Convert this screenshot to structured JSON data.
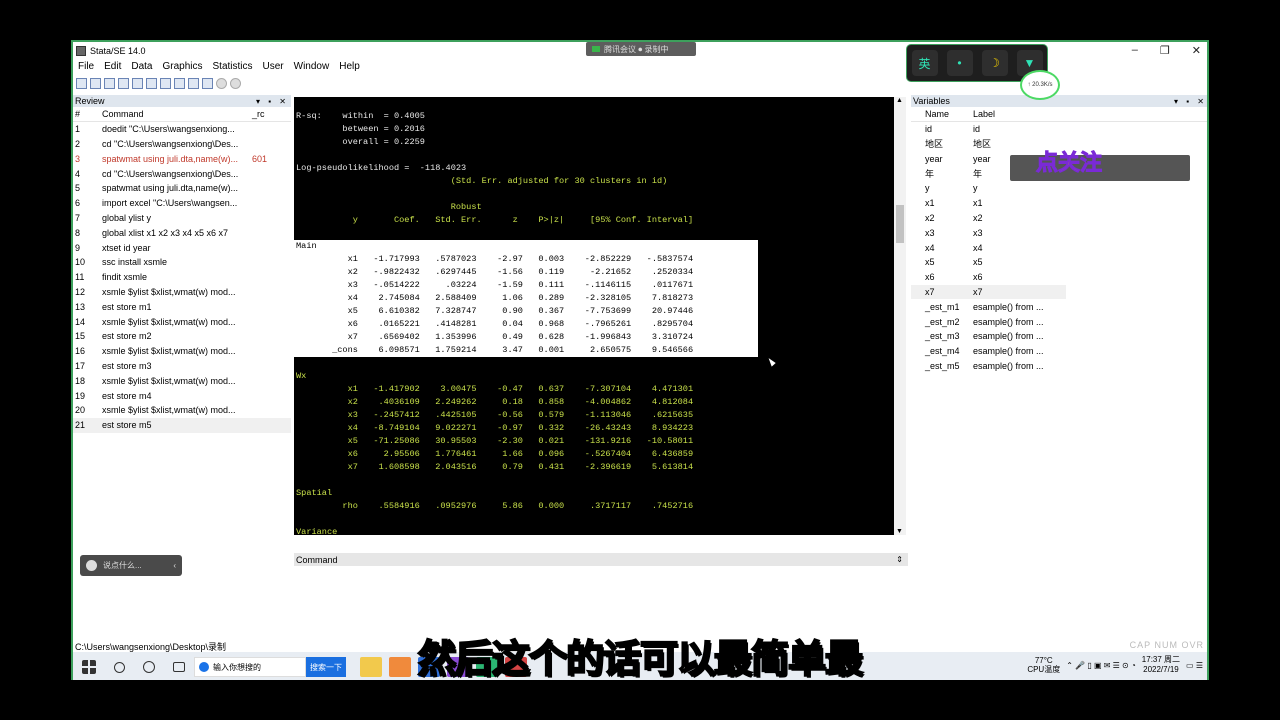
{
  "window": {
    "title": "Stata/SE 14.0",
    "meeting_badge": "腾讯会议 ⏺ 录制中"
  },
  "menu": [
    "File",
    "Edit",
    "Data",
    "Graphics",
    "Statistics",
    "User",
    "Window",
    "Help"
  ],
  "review": {
    "title": "Review",
    "col_num": "#",
    "col_cmd": "Command",
    "col_rc": "_rc",
    "rows": [
      {
        "n": "1",
        "c": "doedit \"C:\\Users\\wangsenxiong...",
        "rc": ""
      },
      {
        "n": "2",
        "c": "cd \"C:\\Users\\wangsenxiong\\Des...",
        "rc": ""
      },
      {
        "n": "3",
        "c": "spatwmat using juli.dta,name(w)...",
        "rc": "601"
      },
      {
        "n": "4",
        "c": "cd \"C:\\Users\\wangsenxiong\\Des...",
        "rc": ""
      },
      {
        "n": "5",
        "c": "spatwmat using juli.dta,name(w)...",
        "rc": ""
      },
      {
        "n": "6",
        "c": "import excel \"C:\\Users\\wangsen...",
        "rc": ""
      },
      {
        "n": "7",
        "c": "global ylist y",
        "rc": ""
      },
      {
        "n": "8",
        "c": "global xlist x1 x2 x3 x4 x5 x6 x7",
        "rc": ""
      },
      {
        "n": "9",
        "c": "xtset id year",
        "rc": ""
      },
      {
        "n": "10",
        "c": "ssc install xsmle",
        "rc": ""
      },
      {
        "n": "11",
        "c": "findit xsmle",
        "rc": ""
      },
      {
        "n": "12",
        "c": "xsmle $ylist $xlist,wmat(w) mod...",
        "rc": ""
      },
      {
        "n": "13",
        "c": "est store m1",
        "rc": ""
      },
      {
        "n": "14",
        "c": "xsmle $ylist $xlist,wmat(w) mod...",
        "rc": ""
      },
      {
        "n": "15",
        "c": "est store m2",
        "rc": ""
      },
      {
        "n": "16",
        "c": "xsmle $ylist $xlist,wmat(w) mod...",
        "rc": ""
      },
      {
        "n": "17",
        "c": "est store m3",
        "rc": ""
      },
      {
        "n": "18",
        "c": "xsmle $ylist $xlist,wmat(w) mod...",
        "rc": ""
      },
      {
        "n": "19",
        "c": "est store m4",
        "rc": ""
      },
      {
        "n": "20",
        "c": "xsmle $ylist $xlist,wmat(w) mod...",
        "rc": ""
      },
      {
        "n": "21",
        "c": "est store m5",
        "rc": ""
      }
    ]
  },
  "results": {
    "lines": [
      {
        "t": "R-sq:    within  = 0.4005",
        "k": "w"
      },
      {
        "t": "         between = 0.2016",
        "k": "w"
      },
      {
        "t": "         overall = 0.2259",
        "k": "w"
      },
      {
        "t": "",
        "k": "w"
      },
      {
        "t": "Log-pseudolikelihood =  -118.4023",
        "k": "w"
      },
      {
        "t": "                              (Std. Err. adjusted for 30 clusters in id)",
        "k": "y"
      },
      {
        "t": "",
        "k": "w"
      },
      {
        "t": "                              Robust",
        "k": "y"
      },
      {
        "t": "           y       Coef.   Std. Err.      z    P>|z|     [95% Conf. Interval]",
        "k": "y"
      },
      {
        "t": "",
        "k": "w"
      },
      {
        "t": "Main",
        "k": "b"
      },
      {
        "t": "          x1   -1.717993   .5787023    -2.97   0.003    -2.852229   -.5837574",
        "k": "b"
      },
      {
        "t": "          x2   -.9822432   .6297445    -1.56   0.119     -2.21652    .2520334",
        "k": "b"
      },
      {
        "t": "          x3   -.0514222     .03224    -1.59   0.111    -.1146115    .0117671",
        "k": "b"
      },
      {
        "t": "          x4    2.745084   2.588409     1.06   0.289    -2.328105    7.818273",
        "k": "b"
      },
      {
        "t": "          x5    6.610382   7.328747     0.90   0.367    -7.753699    20.97446",
        "k": "b"
      },
      {
        "t": "          x6    .0165221   .4148281     0.04   0.968    -.7965261    .8295704",
        "k": "b"
      },
      {
        "t": "          x7    .6569402   1.353996     0.49   0.628    -1.996843    3.310724",
        "k": "b"
      },
      {
        "t": "       _cons    6.098571   1.759214     3.47   0.001     2.650575    9.546566",
        "k": "b"
      },
      {
        "t": "",
        "k": "w"
      },
      {
        "t": "Wx",
        "k": "y"
      },
      {
        "t": "          x1   -1.417902    3.00475    -0.47   0.637    -7.307104    4.471301",
        "k": "y"
      },
      {
        "t": "          x2    .4036109   2.249262     0.18   0.858    -4.004862    4.812084",
        "k": "y"
      },
      {
        "t": "          x3   -.2457412   .4425105    -0.56   0.579    -1.113046    .6215635",
        "k": "y"
      },
      {
        "t": "          x4   -8.749104   9.022271    -0.97   0.332    -26.43243    8.934223",
        "k": "y"
      },
      {
        "t": "          x5   -71.25086   30.95503    -2.30   0.021    -131.9216   -10.58011",
        "k": "y"
      },
      {
        "t": "          x6     2.95506   1.776461     1.66   0.096    -.5267404    6.436859",
        "k": "y"
      },
      {
        "t": "          x7    1.608598   2.043516     0.79   0.431    -2.396619    5.613814",
        "k": "y"
      },
      {
        "t": "",
        "k": "w"
      },
      {
        "t": "Spatial",
        "k": "y"
      },
      {
        "t": "         rho    .5584916   .0952976     5.86   0.000     .3717117    .7452716",
        "k": "y"
      },
      {
        "t": "",
        "k": "w"
      },
      {
        "t": "Variance",
        "k": "y"
      }
    ]
  },
  "command_pane": {
    "title": "Command"
  },
  "variables": {
    "title": "Variables",
    "col_name": "Name",
    "col_label": "Label",
    "rows": [
      {
        "a": "id",
        "b": "id"
      },
      {
        "a": "地区",
        "b": "地区"
      },
      {
        "a": "year",
        "b": "year"
      },
      {
        "a": "年",
        "b": "年"
      },
      {
        "a": "y",
        "b": "y"
      },
      {
        "a": "x1",
        "b": "x1"
      },
      {
        "a": "x2",
        "b": "x2"
      },
      {
        "a": "x3",
        "b": "x3"
      },
      {
        "a": "x4",
        "b": "x4"
      },
      {
        "a": "x5",
        "b": "x5"
      },
      {
        "a": "x6",
        "b": "x6"
      },
      {
        "a": "x7",
        "b": "x7"
      },
      {
        "a": "_est_m1",
        "b": "esample() from ..."
      },
      {
        "a": "_est_m2",
        "b": "esample() from ..."
      },
      {
        "a": "_est_m3",
        "b": "esample() from ..."
      },
      {
        "a": "_est_m4",
        "b": "esample() from ..."
      },
      {
        "a": "_est_m5",
        "b": "esample() from ..."
      }
    ]
  },
  "statusbar": {
    "path": "C:\\Users\\wangsenxiong\\Desktop\\录制",
    "indicators": "CAP  NUM  OVR"
  },
  "taskbar": {
    "search_placeholder": "输入你想搜的",
    "search_button": "搜索一下",
    "temp": "77°C",
    "temp_label": "CPU温度",
    "time": "17:37 周二",
    "date": "2022/7/19"
  },
  "overlay": {
    "ime": "英",
    "net": "↑ 20.3K/s",
    "sticker": "点关注",
    "chat_placeholder": "说点什么...",
    "subtitle": "然后这个的话可以最简单最"
  }
}
